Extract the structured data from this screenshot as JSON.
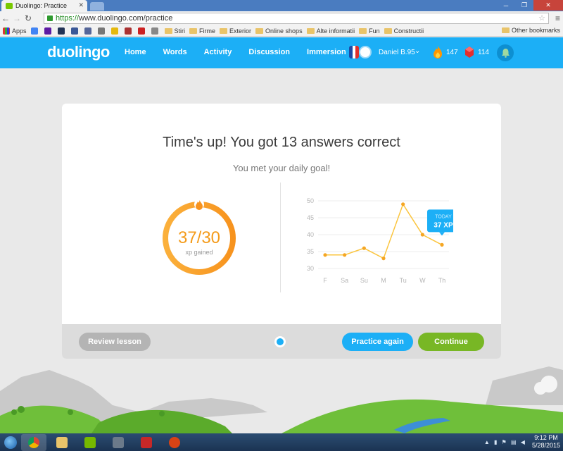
{
  "browser": {
    "tab_title": "Duolingo: Practice",
    "url_scheme": "https://",
    "url_rest": "www.duolingo.com/practice",
    "bookmarks": [
      "Apps",
      "Stiri",
      "Firme",
      "Exterior",
      "Online shops",
      "Alte informatii",
      "Fun",
      "Constructii"
    ],
    "other_bookmarks": "Other bookmarks"
  },
  "header": {
    "logo": "duolingo",
    "nav": [
      "Home",
      "Words",
      "Activity",
      "Discussion",
      "Immersion"
    ],
    "username": "Daniel B.95",
    "streak": "147",
    "lingots": "114"
  },
  "result": {
    "title": "Time's up! You got 13 answers correct",
    "subtitle": "You met your daily goal!",
    "xp_value": "37/30",
    "xp_label": "xp gained",
    "xp_fraction": 1.0
  },
  "chart_data": {
    "type": "line",
    "categories": [
      "F",
      "Sa",
      "Su",
      "M",
      "Tu",
      "W",
      "Th"
    ],
    "values": [
      34,
      34,
      36,
      33,
      49,
      40,
      37
    ],
    "y_ticks": [
      50,
      45,
      40,
      35,
      30
    ],
    "ylim": [
      30,
      50
    ],
    "tooltip_title": "TODAY",
    "tooltip_value": "37 XP",
    "line_color": "#fbc53e"
  },
  "footer": {
    "review_label": "Review lesson",
    "practice_label": "Practice again",
    "continue_label": "Continue"
  },
  "taskbar": {
    "time": "9:12 PM",
    "date": "5/28/2015"
  },
  "colors": {
    "brand_blue": "#1caff6",
    "brand_green": "#78b725",
    "ring_orange": "#f49b1a"
  }
}
